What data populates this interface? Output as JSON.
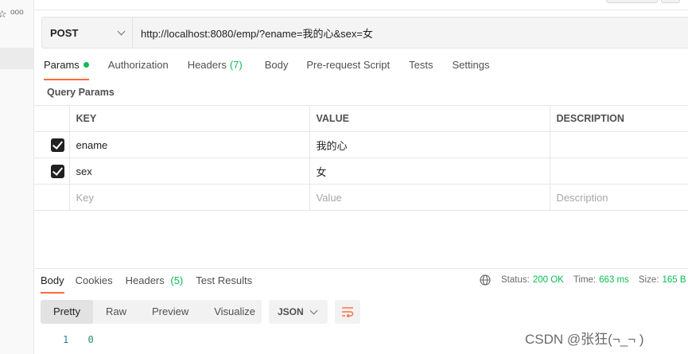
{
  "sidebar": {
    "star_glyph": "☆",
    "more_glyph": "ooo"
  },
  "request": {
    "method": "POST",
    "url": "http://localhost:8080/emp/?ename=我的心&sex=女"
  },
  "request_tabs": [
    {
      "label": "Params",
      "active": true,
      "indicator": "green-dot"
    },
    {
      "label": "Authorization"
    },
    {
      "label": "Headers",
      "count": "(7)"
    },
    {
      "label": "Body"
    },
    {
      "label": "Pre-request Script"
    },
    {
      "label": "Tests"
    },
    {
      "label": "Settings"
    }
  ],
  "query_params": {
    "title": "Query Params",
    "columns": [
      "KEY",
      "VALUE",
      "DESCRIPTION"
    ],
    "rows": [
      {
        "checked": true,
        "key": "ename",
        "value": "我的心",
        "description": ""
      },
      {
        "checked": true,
        "key": "sex",
        "value": "女",
        "description": ""
      }
    ],
    "placeholder": {
      "key": "Key",
      "value": "Value",
      "description": "Description"
    }
  },
  "response_tabs": [
    {
      "label": "Body",
      "active": true
    },
    {
      "label": "Cookies"
    },
    {
      "label": "Headers",
      "count": "(5)"
    },
    {
      "label": "Test Results"
    }
  ],
  "response_status": {
    "status_label": "Status:",
    "status_value": "200 OK",
    "time_label": "Time:",
    "time_value": "663 ms",
    "size_label": "Size:",
    "size_value": "165 B"
  },
  "format_options": [
    "Pretty",
    "Raw",
    "Preview",
    "Visualize"
  ],
  "active_format": "Pretty",
  "language": "JSON",
  "code": {
    "line_number": "1",
    "content": "0"
  },
  "watermark": "CSDN @张狂(¬_¬ )",
  "colors": {
    "accent": "#ff6c37",
    "success": "#0cbb52"
  },
  "icons": [
    "star-icon",
    "more-icon",
    "chevron-down-icon",
    "checkbox-checked-icon",
    "globe-icon",
    "wrap-lines-icon"
  ]
}
